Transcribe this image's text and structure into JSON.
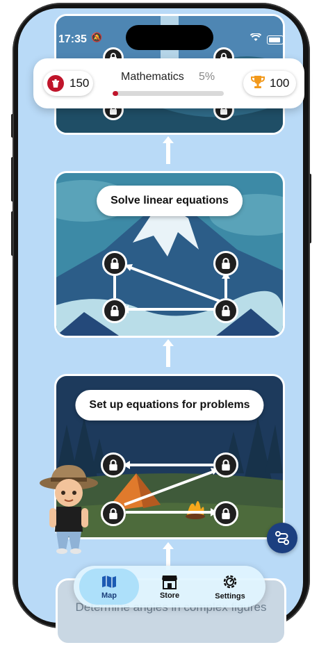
{
  "status_bar": {
    "time": "17:35"
  },
  "header": {
    "gems": "150",
    "subject": "Mathematics",
    "progress_label": "5%",
    "progress_value": 0.05,
    "trophies": "100",
    "gem_color": "#c0152b",
    "trophy_color": "#f2991c"
  },
  "lessons": {
    "linear": {
      "title": "Solve linear equations"
    },
    "setup": {
      "title": "Set up equations for problems"
    },
    "next": {
      "title": "Determine angles in complex figures"
    }
  },
  "tabs": [
    {
      "label": "Map",
      "icon": "map-icon",
      "active": true
    },
    {
      "label": "Store",
      "icon": "store-icon",
      "active": false
    },
    {
      "label": "Settings",
      "icon": "gear-icon",
      "active": false
    }
  ],
  "colors": {
    "background": "#b9daf7",
    "accent": "#1c3f80"
  }
}
